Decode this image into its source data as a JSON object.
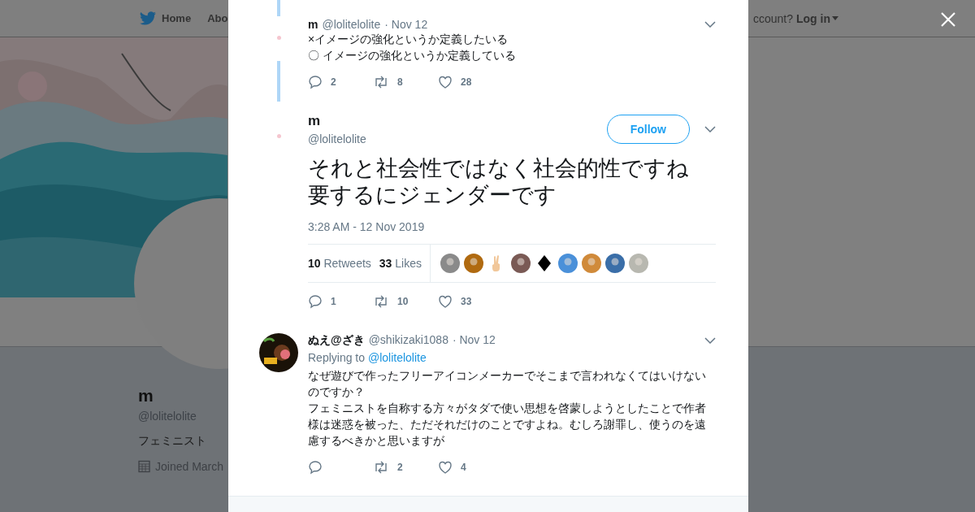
{
  "nav": {
    "items": [
      {
        "label": "Home"
      },
      {
        "label": "Abo"
      }
    ],
    "account_prompt": "ccount?",
    "login": "Log in"
  },
  "profile": {
    "name": "m",
    "handle": "@lolitelolite",
    "bio": "フェミニスト",
    "joined": "Joined March"
  },
  "tweets": [
    {
      "kind": "thread",
      "name": "m",
      "handle": "@lolitelolite",
      "date": "· Nov 12",
      "lines": [
        "×イメージの強化というか定義したいる",
        "〇 イメージの強化というか定義している"
      ],
      "replies": "2",
      "retweets": "8",
      "likes": "28"
    },
    {
      "kind": "focus",
      "name": "m",
      "handle": "@lolitelolite",
      "follow": "Follow",
      "lines": [
        "それと社会性ではなく社会的性ですね",
        "要するにジェンダーです"
      ],
      "timestamp": "3:28 AM - 12 Nov 2019",
      "retweet_count": "10",
      "retweet_label": "Retweets",
      "like_count": "33",
      "like_label": "Likes",
      "replies": "1",
      "retweets": "10",
      "likes": "33"
    },
    {
      "kind": "reply",
      "name": "ぬえ@ざき",
      "handle": "@shikizaki1088",
      "date": "· Nov 12",
      "replying_label": "Replying to",
      "replying_handle": "@lolitelolite",
      "lines": [
        "なぜ遊びで作ったフリーアイコンメーカーでそこまで言われなくてはいけないのですか？",
        "フェミニストを自称する方々がタダで使い思想を啓蒙しようとしたことで作者様は迷惑を被った、ただそれだけのことですよね。むしろ謝罪し、使うのを遠慮するべきかと思いますが"
      ],
      "retweets": "2",
      "likes": "4"
    }
  ]
}
